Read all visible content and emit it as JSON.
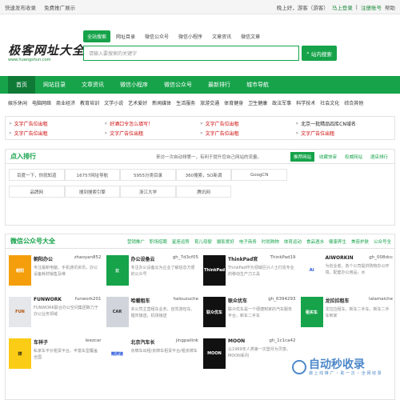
{
  "topbar": {
    "left": [
      "快速发布收录",
      "免费推广展示"
    ],
    "greeting": "晚上好，游客（游客）",
    "login": "马上登录",
    "sep": "|",
    "register": "注册账号",
    "help": "帮助"
  },
  "logo": {
    "cn": "极客网址大全",
    "url": "www.huangshun.com"
  },
  "search": {
    "tabs": [
      "全站搜索",
      "网址目录",
      "微信公众号",
      "微信小程序",
      "文章资讯",
      "微信文章"
    ],
    "placeholder": "请输入要搜索的关键字",
    "button": "站内搜索"
  },
  "nav": [
    "首页",
    "网站目录",
    "文章资讯",
    "微信小程序",
    "微信公众号",
    "最新排行",
    "城市导航"
  ],
  "subnav": [
    "娱乐休闲",
    "电脑网络",
    "商业经济",
    "教育培训",
    "文学小说",
    "艺术爱好",
    "新闻媒体",
    "生活服务",
    "旅游交通",
    "体育健身",
    "卫生健康",
    "政法军事",
    "科学技术",
    "社会文化",
    "综合其他"
  ],
  "ads": [
    {
      "b": "»",
      "t": "文字广告位出租",
      "c": "red"
    },
    {
      "b": "»",
      "t": "好酒口令怎么填写！",
      "c": "red"
    },
    {
      "b": "»",
      "t": "文字广告位出租",
      "c": "red"
    },
    {
      "b": "»",
      "t": "北京一批精品四库CN域名",
      "c": "dark"
    },
    {
      "b": "»",
      "t": "文字广告位出租",
      "c": "red"
    },
    {
      "b": "»",
      "t": "文字广告位出租",
      "c": "red"
    },
    {
      "b": "»",
      "t": "文字广告位出租",
      "c": "red"
    },
    {
      "b": "»",
      "t": "文字广告位出租",
      "c": "red"
    }
  ],
  "click": {
    "title": "点入排行",
    "note": "来访一次自动排第一，有利于提升您自己网站的流量。",
    "tabs": [
      "推荐网站",
      "收藏快审",
      "权威网站",
      "酒店排行"
    ],
    "cells": [
      "百度一下，你就知道",
      "16757网址导航",
      "5955分类目录",
      "360搜索，SO新调",
      "GoogCN",
      "品牌网",
      "搜到搜索引擎",
      "浙江大学",
      "腾讯网",
      ""
    ]
  },
  "wx": {
    "title": "微信公众号大全",
    "cats": [
      "营销推广",
      "职场招聘",
      "星座运势",
      "育儿母婴",
      "摄影爱好",
      "电子商务",
      "时尚购物",
      "体育运动",
      "食品酒水",
      "健康养生",
      "美容护肤",
      "公众号全"
    ],
    "cards": [
      {
        "name": "朝阳办公",
        "id": "zhaoyan852",
        "desc": "专注最新电脑、手机通讯资讯，办公设备耗材销售及维",
        "pic": "朝阳",
        "bg": "#f59e0b",
        "fg": "#fff"
      },
      {
        "name": "办公设备云",
        "id": "gh_7d3cf05",
        "desc": "专注办公设备云为企业了解信息方便的公众号",
        "pic": "云",
        "bg": "#16a34a",
        "fg": "#fff"
      },
      {
        "name": "ThinkPad官",
        "id": "ThinkPad19",
        "desc": "ThinkPad作为领域巨兴人士打造专业的移动生产力工具",
        "pic": "ThinkPad",
        "bg": "#111",
        "fg": "#fff"
      },
      {
        "name": "AIWORKIN",
        "id": "gh_008dcc",
        "desc": "为创业者，各个公司提供购物办公环境，配套办公用品，水",
        "pic": "Ai",
        "bg": "#fff",
        "fg": "#1d4ed8"
      },
      {
        "name": "FUNWORK",
        "id": "funwork201",
        "desc": "FUNWORK联合办公空间集团致力于办公业务领域",
        "pic": "FUN",
        "bg": "#e5e7eb",
        "fg": "#b45309"
      },
      {
        "name": "哈暖租车",
        "id": "halouzuche",
        "desc": "本公司主营租车业务，自驾游包车、婚庆接送，机场接送",
        "pic": "CAR",
        "bg": "#d1d5db",
        "fg": "#333"
      },
      {
        "name": "联众优车",
        "id": "gh_6394293",
        "desc": "联众优车是一个便捷到家的汽车服务平台，新车二手车",
        "pic": "联众优车",
        "bg": "#111",
        "fg": "#fff"
      },
      {
        "name": "龙拉拉租车",
        "id": "lalamaiche",
        "desc": "龙拉拉租车，新车二手车，新车二手车到家",
        "pic": "租买车",
        "bg": "#16a34a",
        "fg": "#fff"
      },
      {
        "name": "车祥子",
        "id": "leezcar",
        "desc": "私家车平价租赁平台。丰富车型覆盖全国",
        "pic": "祥",
        "bg": "#facc15",
        "fg": "#111"
      },
      {
        "name": "北京汽车长",
        "id": "jingpailink",
        "desc": "京牌车出租/京牌车租赁平台/租京牌车",
        "pic": "精牌链",
        "bg": "#fff",
        "fg": "#1d4ed8"
      },
      {
        "name": "MOON",
        "id": "gh_1c1ca42",
        "desc": "以1969年人类第一次登月为灵感，MOON系列",
        "pic": "MOON",
        "bg": "#111",
        "fg": "#fff"
      },
      {
        "name": "",
        "id": "",
        "desc": "",
        "pic": "",
        "bg": "#fff",
        "fg": "#fff"
      }
    ]
  },
  "watermark": {
    "t1": "自动秒收录",
    "t2": "做 上 线 推 广 ・ 助 一 次 ・ 全 网 收 录"
  }
}
